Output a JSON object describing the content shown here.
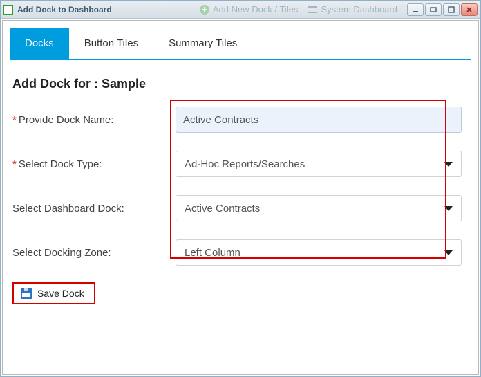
{
  "window": {
    "title": "Add Dock to Dashboard"
  },
  "header": {
    "add_link": "Add New Dock / Tiles",
    "system_link": "System Dashboard"
  },
  "tabs": {
    "docks": "Docks",
    "button_tiles": "Button Tiles",
    "summary_tiles": "Summary Tiles",
    "active": "docks"
  },
  "form": {
    "heading": "Add Dock for : Sample",
    "labels": {
      "dock_name": "Provide Dock Name:",
      "dock_type": "Select Dock Type:",
      "dashboard_dock": "Select Dashboard Dock:",
      "docking_zone": "Select Docking Zone:"
    },
    "values": {
      "dock_name": "Active Contracts",
      "dock_type": "Ad-Hoc Reports/Searches",
      "dashboard_dock": "Active Contracts",
      "docking_zone": "Left Column"
    },
    "save_label": "Save Dock"
  }
}
